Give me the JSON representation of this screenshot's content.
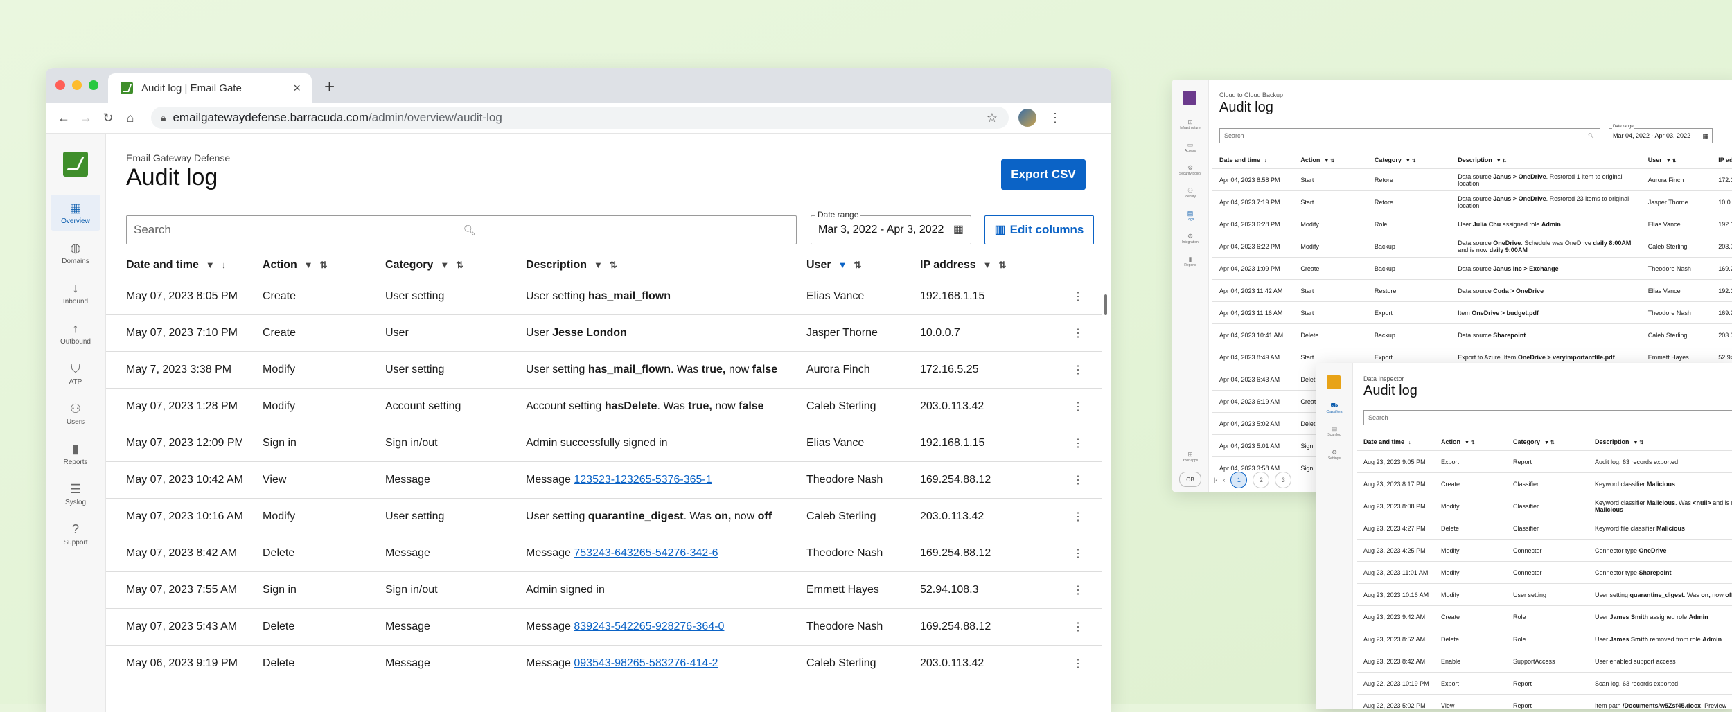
{
  "browser": {
    "tab_title": "Audit log | Email Gate",
    "tab_close": "×",
    "new_tab": "+",
    "url_domain": "emailgatewaydefense.barracuda.com",
    "url_path": "/admin/overview/audit-log"
  },
  "colors": {
    "accent": "#0b63c6",
    "brand_green": "#3f8e2b",
    "brand_purple": "#6b3a8c",
    "brand_orange": "#e8a317",
    "backdrop": "#e8f5dc"
  },
  "sidebar": {
    "items": [
      {
        "label": "Overview",
        "icon": "grid-icon",
        "active": true
      },
      {
        "label": "Domains",
        "icon": "globe-icon"
      },
      {
        "label": "Inbound",
        "icon": "arrow-down-icon"
      },
      {
        "label": "Outbound",
        "icon": "arrow-up-icon"
      },
      {
        "label": "ATP",
        "icon": "shield-icon"
      },
      {
        "label": "Users",
        "icon": "users-icon"
      },
      {
        "label": "Reports",
        "icon": "bar-chart-icon"
      },
      {
        "label": "Syslog",
        "icon": "list-icon"
      },
      {
        "label": "Support",
        "icon": "help-icon"
      }
    ]
  },
  "main": {
    "breadcrumb": "Email Gateway Defense",
    "title": "Audit log",
    "export_label": "Export CSV",
    "search_placeholder": "Search",
    "date_range_label": "Date range",
    "date_range_value": "Mar 3, 2022 - Apr 3, 2022",
    "edit_columns_label": "Edit columns",
    "columns": [
      "Date and time",
      "Action",
      "Category",
      "Description",
      "User",
      "IP address"
    ],
    "rows": [
      {
        "date": "May 07, 2023 8:05 PM",
        "action": "Create",
        "category": "User setting",
        "desc": [
          [
            "User setting ",
            ""
          ],
          [
            "has_mail_flown",
            "b"
          ]
        ],
        "user": "Elias Vance",
        "ip": "192.168.1.15"
      },
      {
        "date": "May 07, 2023 7:10 PM",
        "action": "Create",
        "category": "User",
        "desc": [
          [
            "User ",
            ""
          ],
          [
            "Jesse London",
            "b"
          ]
        ],
        "user": "Jasper Thorne",
        "ip": "10.0.0.7"
      },
      {
        "date": "May 7, 2023 3:38 PM",
        "action": "Modify",
        "category": "User setting",
        "desc": [
          [
            "User setting ",
            ""
          ],
          [
            "has_mail_flown",
            "b"
          ],
          [
            ". Was ",
            ""
          ],
          [
            "true,",
            "b"
          ],
          [
            " now ",
            ""
          ],
          [
            "false",
            "b"
          ]
        ],
        "user": "Aurora Finch",
        "ip": "172.16.5.25"
      },
      {
        "date": "May 07, 2023 1:28 PM",
        "action": "Modify",
        "category": "Account setting",
        "desc": [
          [
            "Account setting ",
            ""
          ],
          [
            "hasDelete",
            "b"
          ],
          [
            ". Was ",
            ""
          ],
          [
            "true,",
            "b"
          ],
          [
            " now ",
            ""
          ],
          [
            "false",
            "b"
          ]
        ],
        "user": "Caleb Sterling",
        "ip": "203.0.113.42"
      },
      {
        "date": "May 07, 2023 12:09 PM",
        "action": "Sign in",
        "category": "Sign in/out",
        "desc": [
          [
            "Admin successfully signed in",
            ""
          ]
        ],
        "user": "Elias Vance",
        "ip": "192.168.1.15"
      },
      {
        "date": "May 07, 2023 10:42 AM",
        "action": "View",
        "category": "Message",
        "desc": [
          [
            "Message ",
            ""
          ],
          [
            "123523-123265-5376-365-1",
            "a"
          ]
        ],
        "user": "Theodore Nash",
        "ip": "169.254.88.12"
      },
      {
        "date": "May 07, 2023 10:16 AM",
        "action": "Modify",
        "category": "User setting",
        "desc": [
          [
            "User setting ",
            ""
          ],
          [
            "quarantine_digest",
            "b"
          ],
          [
            ". Was ",
            ""
          ],
          [
            "on,",
            "b"
          ],
          [
            " now ",
            ""
          ],
          [
            "off",
            "b"
          ]
        ],
        "user": "Caleb Sterling",
        "ip": "203.0.113.42"
      },
      {
        "date": "May 07, 2023 8:42 AM",
        "action": "Delete",
        "category": "Message",
        "desc": [
          [
            "Message ",
            ""
          ],
          [
            "753243-643265-54276-342-6",
            "a"
          ]
        ],
        "user": "Theodore Nash",
        "ip": "169.254.88.12"
      },
      {
        "date": "May 07, 2023 7:55 AM",
        "action": "Sign in",
        "category": "Sign in/out",
        "desc": [
          [
            "Admin signed in",
            ""
          ]
        ],
        "user": "Emmett Hayes",
        "ip": "52.94.108.3"
      },
      {
        "date": "May 07, 2023 5:43 AM",
        "action": "Delete",
        "category": "Message",
        "desc": [
          [
            "Message ",
            ""
          ],
          [
            "839243-542265-928276-364-0",
            "a"
          ]
        ],
        "user": "Theodore Nash",
        "ip": "169.254.88.12"
      },
      {
        "date": "May 06, 2023 9:19 PM",
        "action": "Delete",
        "category": "Message",
        "desc": [
          [
            "Message ",
            ""
          ],
          [
            "093543-98265-583276-414-2",
            "a"
          ]
        ],
        "user": "Caleb Sterling",
        "ip": "203.0.113.42"
      }
    ]
  },
  "window2": {
    "breadcrumb": "Cloud to Cloud Backup",
    "title": "Audit log",
    "search_placeholder": "Search",
    "date_range_label": "Date range",
    "date_range_value": "Mar 04, 2022 - Apr 03, 2022",
    "sidebar": [
      "Infrastructure",
      "Access",
      "Security policy",
      "Identity",
      "Logs",
      "Integration",
      "Reports"
    ],
    "your_apps": "Your apps",
    "user_initials": "OB",
    "pages": [
      "1",
      "2",
      "3"
    ],
    "columns": [
      "Date and time",
      "Action",
      "Category",
      "Description",
      "User",
      "IP ad"
    ],
    "rows": [
      {
        "date": "Apr 04, 2023 8:58 PM",
        "action": "Start",
        "category": "Retore",
        "desc": [
          [
            "Data source ",
            ""
          ],
          [
            "Janus > OneDrive",
            "b"
          ],
          [
            ". Restored 1 item to original location",
            ""
          ]
        ],
        "user": "Aurora Finch",
        "ip": "172.1"
      },
      {
        "date": "Apr 04, 2023 7:19 PM",
        "action": "Start",
        "category": "Retore",
        "desc": [
          [
            "Data source ",
            ""
          ],
          [
            "Janus > OneDrive",
            "b"
          ],
          [
            ". Restored 23 items to original location",
            ""
          ]
        ],
        "user": "Jasper Thorne",
        "ip": "10.0.0"
      },
      {
        "date": "Apr 04, 2023 6:28 PM",
        "action": "Modify",
        "category": "Role",
        "desc": [
          [
            "User ",
            ""
          ],
          [
            "Julia Chu",
            "b"
          ],
          [
            " assigned role ",
            ""
          ],
          [
            "Admin",
            "b"
          ]
        ],
        "user": "Elias Vance",
        "ip": "192.1"
      },
      {
        "date": "Apr 04, 2023 6:22 PM",
        "action": "Modify",
        "category": "Backup",
        "desc": [
          [
            "Data source ",
            ""
          ],
          [
            "OneDrive",
            "b"
          ],
          [
            ". Schedule was OneDrive ",
            ""
          ],
          [
            "daily 8:00AM",
            "b"
          ],
          [
            " and is now ",
            ""
          ],
          [
            "daily 9:00AM",
            "b"
          ]
        ],
        "user": "Caleb Sterling",
        "ip": "203.0"
      },
      {
        "date": "Apr 04, 2023 1:09 PM",
        "action": "Create",
        "category": "Backup",
        "desc": [
          [
            "Data source ",
            ""
          ],
          [
            "Janus Inc > Exchange",
            "b"
          ]
        ],
        "user": "Theodore Nash",
        "ip": "169.2"
      },
      {
        "date": "Apr 04, 2023 11:42 AM",
        "action": "Start",
        "category": "Restore",
        "desc": [
          [
            "Data source ",
            ""
          ],
          [
            "Cuda > OneDrive",
            "b"
          ]
        ],
        "user": "Elias Vance",
        "ip": "192.1"
      },
      {
        "date": "Apr 04, 2023 11:16 AM",
        "action": "Start",
        "category": "Export",
        "desc": [
          [
            "Item ",
            ""
          ],
          [
            "OneDrive > budget.pdf",
            "b"
          ]
        ],
        "user": "Theodore Nash",
        "ip": "169.2"
      },
      {
        "date": "Apr 04, 2023 10:41 AM",
        "action": "Delete",
        "category": "Backup",
        "desc": [
          [
            "Data source ",
            ""
          ],
          [
            "Sharepoint",
            "b"
          ]
        ],
        "user": "Caleb Sterling",
        "ip": "203.0"
      },
      {
        "date": "Apr 04, 2023 8:49 AM",
        "action": "Start",
        "category": "Export",
        "desc": [
          [
            "Export to Azure. Item ",
            ""
          ],
          [
            "OneDrive > veryimportantfile.pdf",
            "b"
          ]
        ],
        "user": "Emmett Hayes",
        "ip": "52.94"
      },
      {
        "date": "Apr 04, 2023 6:43 AM",
        "action": "Delet",
        "category": "",
        "desc": [],
        "user": "",
        "ip": ""
      },
      {
        "date": "Apr 04, 2023 6:19 AM",
        "action": "Creat",
        "category": "",
        "desc": [],
        "user": "",
        "ip": ""
      },
      {
        "date": "Apr 04, 2023 5:02 AM",
        "action": "Delet",
        "category": "",
        "desc": [],
        "user": "",
        "ip": ""
      },
      {
        "date": "Apr 04, 2023 5:01 AM",
        "action": "Sign",
        "category": "",
        "desc": [],
        "user": "",
        "ip": ""
      },
      {
        "date": "Apr 04, 2023 3:58 AM",
        "action": "Sign",
        "category": "",
        "desc": [],
        "user": "",
        "ip": ""
      }
    ]
  },
  "window3": {
    "breadcrumb": "Data Inspector",
    "title": "Audit log",
    "search_placeholder": "Search",
    "sidebar": [
      "Classifiers",
      "Scan log",
      "Settings"
    ],
    "columns": [
      "Date and time",
      "Action",
      "Category",
      "Description"
    ],
    "rows": [
      {
        "date": "Aug 23, 2023 9:05 PM",
        "action": "Export",
        "category": "Report",
        "desc": [
          [
            "Audit log. 63 records exported",
            ""
          ]
        ]
      },
      {
        "date": "Aug 23, 2023 8:17 PM",
        "action": "Create",
        "category": "Classifier",
        "desc": [
          [
            "Keyword classifier ",
            ""
          ],
          [
            "Malicious",
            "b"
          ]
        ]
      },
      {
        "date": "Aug 23, 2023 8:08 PM",
        "action": "Modify",
        "category": "Classifier",
        "desc": [
          [
            "Keyword classifier ",
            ""
          ],
          [
            "Malicious",
            "b"
          ],
          [
            ". Was ",
            ""
          ],
          [
            "<null>",
            "b"
          ],
          [
            " and is now ",
            ""
          ],
          [
            "Malicious",
            "b"
          ]
        ]
      },
      {
        "date": "Aug 23, 2023 4:27 PM",
        "action": "Delete",
        "category": "Classifier",
        "desc": [
          [
            "Keyword file classifier ",
            ""
          ],
          [
            "Malicious",
            "b"
          ]
        ]
      },
      {
        "date": "Aug 23, 2023 4:25 PM",
        "action": "Modify",
        "category": "Connector",
        "desc": [
          [
            "Connector type ",
            ""
          ],
          [
            "OneDrive",
            "b"
          ]
        ]
      },
      {
        "date": "Aug 23, 2023 11:01 AM",
        "action": "Modify",
        "category": "Connector",
        "desc": [
          [
            "Connector type ",
            ""
          ],
          [
            "Sharepoint",
            "b"
          ]
        ]
      },
      {
        "date": "Aug 23, 2023 10:16 AM",
        "action": "Modify",
        "category": "User setting",
        "desc": [
          [
            "User setting ",
            ""
          ],
          [
            "quarantine_digest",
            "b"
          ],
          [
            ". Was ",
            ""
          ],
          [
            "on,",
            "b"
          ],
          [
            " now ",
            ""
          ],
          [
            "off",
            "b"
          ]
        ]
      },
      {
        "date": "Aug 23, 2023 9:42 AM",
        "action": "Create",
        "category": "Role",
        "desc": [
          [
            "User ",
            ""
          ],
          [
            "James Smith",
            "b"
          ],
          [
            " assigned role ",
            ""
          ],
          [
            "Admin",
            "b"
          ]
        ]
      },
      {
        "date": "Aug 23, 2023 8:52 AM",
        "action": "Delete",
        "category": "Role",
        "desc": [
          [
            "User ",
            ""
          ],
          [
            "James Smith",
            "b"
          ],
          [
            " removed from role ",
            ""
          ],
          [
            "Admin",
            "b"
          ]
        ]
      },
      {
        "date": "Aug 23, 2023 8:42 AM",
        "action": "Enable",
        "category": "SupportAccess",
        "desc": [
          [
            "User enabled support access",
            ""
          ]
        ]
      },
      {
        "date": "Aug 22, 2023 10:19 PM",
        "action": "Export",
        "category": "Report",
        "desc": [
          [
            "Scan log. 63 records exported",
            ""
          ]
        ]
      },
      {
        "date": "Aug 22, 2023 5:02 PM",
        "action": "View",
        "category": "Report",
        "desc": [
          [
            "Item path ",
            ""
          ],
          [
            "/Documents/w5Zsf45.docx",
            "b"
          ],
          [
            ". Preview",
            ""
          ]
        ]
      }
    ]
  }
}
